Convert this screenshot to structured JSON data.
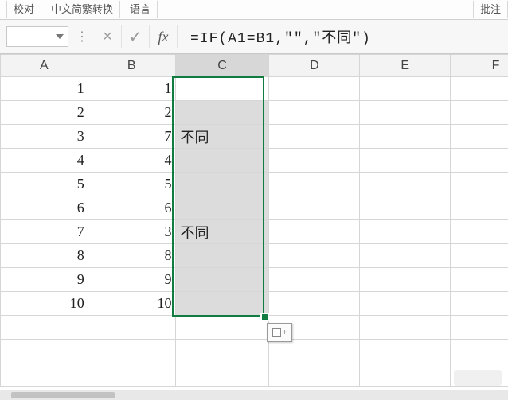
{
  "ribbon": {
    "btn_proof": "校对",
    "btn_convert": "中文简繁转换",
    "btn_lang": "语言",
    "btn_annotate": "批注"
  },
  "formula_bar": {
    "name_box_value": "",
    "fx_label": "fx",
    "formula": "=IF(A1=B1,\"\",\"不同\")"
  },
  "columns": [
    "A",
    "B",
    "C",
    "D",
    "E",
    "F"
  ],
  "rows": [
    {
      "a": "1",
      "b": "1",
      "c": ""
    },
    {
      "a": "2",
      "b": "2",
      "c": ""
    },
    {
      "a": "3",
      "b": "7",
      "c": "不同"
    },
    {
      "a": "4",
      "b": "4",
      "c": ""
    },
    {
      "a": "5",
      "b": "5",
      "c": ""
    },
    {
      "a": "6",
      "b": "6",
      "c": ""
    },
    {
      "a": "7",
      "b": "3",
      "c": "不同"
    },
    {
      "a": "8",
      "b": "8",
      "c": ""
    },
    {
      "a": "9",
      "b": "9",
      "c": ""
    },
    {
      "a": "10",
      "b": "10",
      "c": ""
    }
  ],
  "chart_data": {
    "type": "table",
    "title": "",
    "columns": [
      "A",
      "B",
      "C"
    ],
    "rows": [
      [
        1,
        1,
        ""
      ],
      [
        2,
        2,
        ""
      ],
      [
        3,
        7,
        "不同"
      ],
      [
        4,
        4,
        ""
      ],
      [
        5,
        5,
        ""
      ],
      [
        6,
        6,
        ""
      ],
      [
        7,
        3,
        "不同"
      ],
      [
        8,
        8,
        ""
      ],
      [
        9,
        9,
        ""
      ],
      [
        10,
        10,
        ""
      ]
    ],
    "formula_C": "=IF(A1=B1,\"\",\"不同\")"
  },
  "selection": {
    "range": "C1:C10",
    "active": "C1"
  }
}
